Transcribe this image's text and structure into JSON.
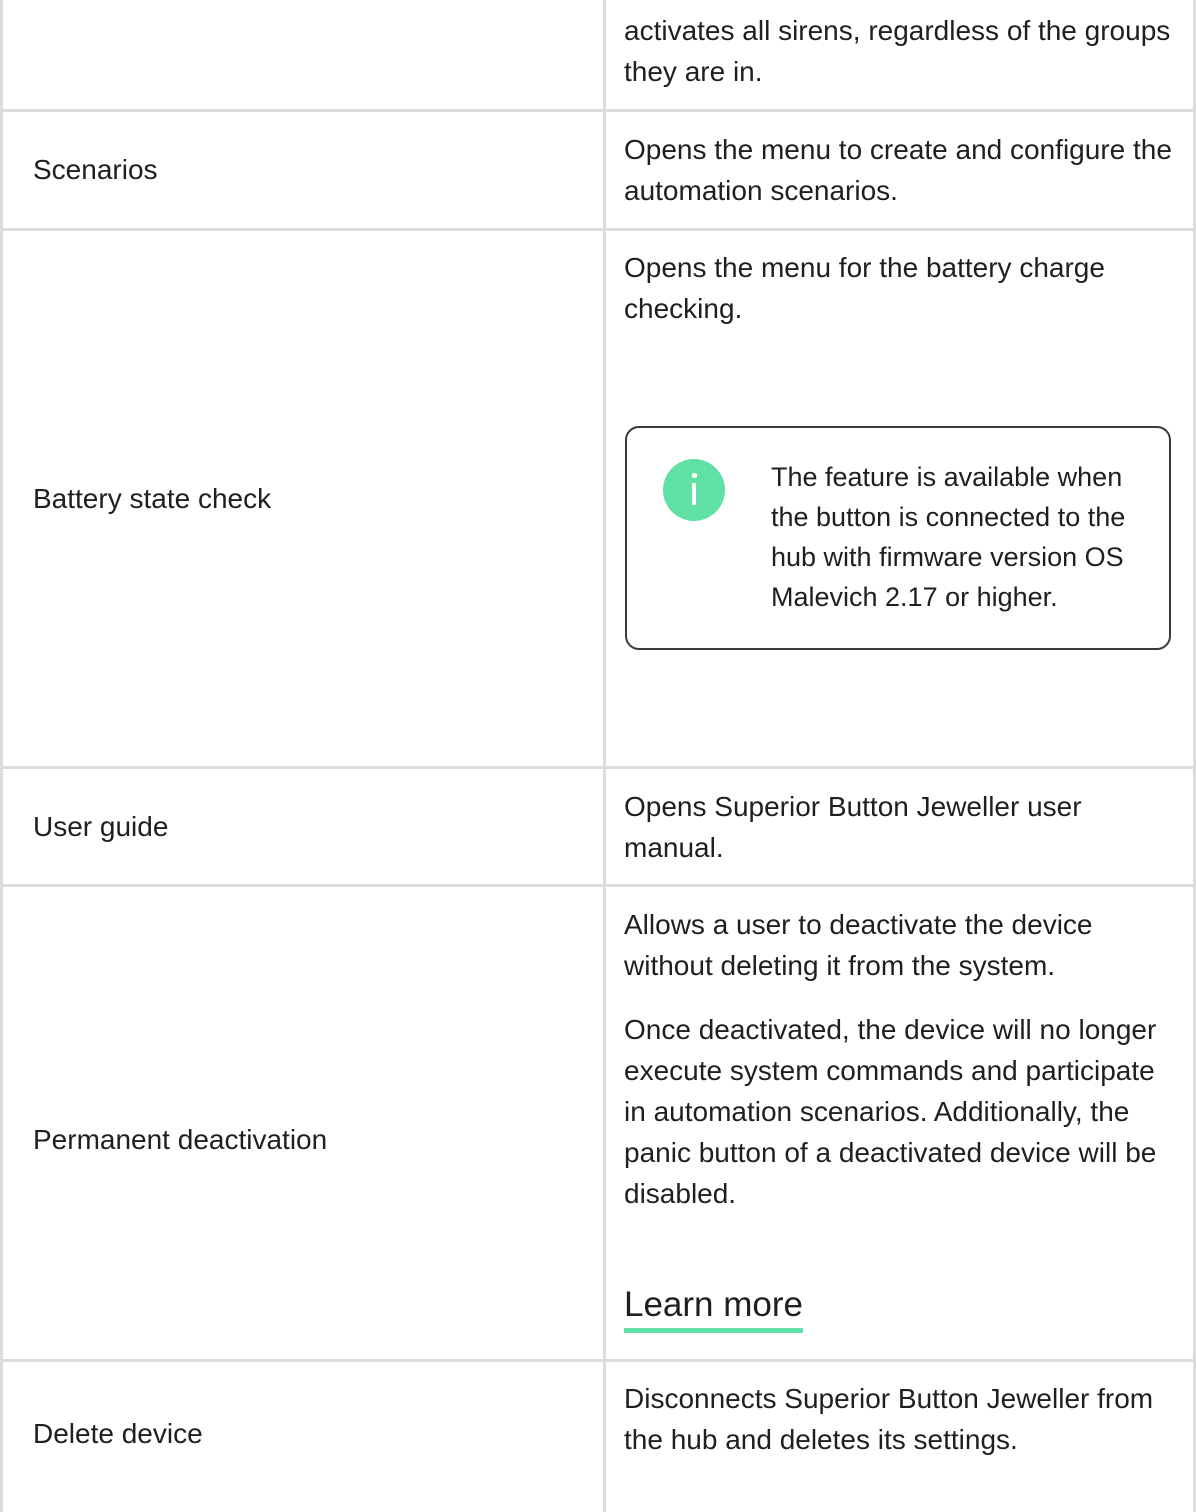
{
  "table": {
    "rows": [
      {
        "name": "",
        "description": [
          "activates all sirens, regardless of the groups they are in."
        ]
      },
      {
        "name": "Scenarios",
        "description": [
          "Opens the menu to create and configure the automation scenarios."
        ]
      },
      {
        "name": "Battery state check",
        "description": [
          "Opens the menu for the battery charge checking."
        ],
        "note": "The feature is available when the button is connected to the hub with firmware version OS Malevich 2.17 or higher.",
        "note_icon": "info-icon"
      },
      {
        "name": "User guide",
        "description": [
          "Opens Superior Button Jeweller user manual."
        ]
      },
      {
        "name": "Permanent deactivation",
        "description": [
          "Allows a user to deactivate the device without deleting it from the system.",
          "Once deactivated, the device will no longer execute system commands and participate in automation scenarios. Additionally, the panic button of a deactivated device will be disabled."
        ],
        "link": "Learn more"
      },
      {
        "name": "Delete device",
        "description": [
          "Disconnects Superior Button Jeweller from the hub and deletes its settings."
        ]
      }
    ]
  },
  "colors": {
    "accent": "#5fe0a5",
    "border": "#dcdcdc",
    "text": "#1f1f1f"
  }
}
